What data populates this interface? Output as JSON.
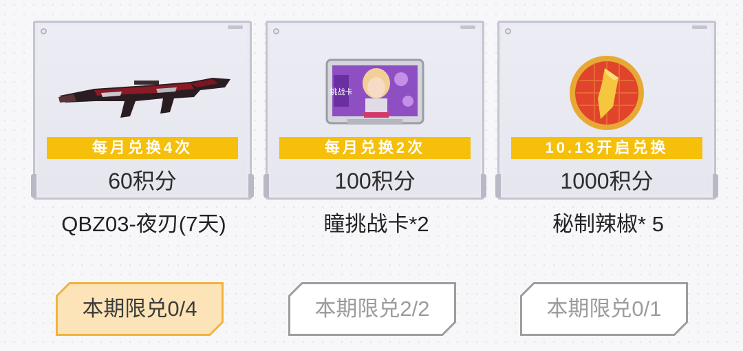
{
  "items": [
    {
      "image_icon": "rifle-icon",
      "limit_banner": "每月兑换4次",
      "price": "60积分",
      "name": "QBZ03-夜刃(7天)",
      "button_label": "本期限兑0/4",
      "button_state": "active"
    },
    {
      "image_icon": "challenge-card-icon",
      "limit_banner": "每月兑换2次",
      "price": "100积分",
      "name": "瞳挑战卡*2",
      "button_label": "本期限兑2/2",
      "button_state": "disabled",
      "image_text": "挑战卡"
    },
    {
      "image_icon": "chili-coin-icon",
      "limit_banner": "10.13开启兑换",
      "price": "1000积分",
      "name": "秘制辣椒* 5",
      "button_label": "本期限兑0/1",
      "button_state": "disabled"
    }
  ],
  "colors": {
    "banner": "#f5bf0a",
    "active_button_fill": "#fde4b8",
    "active_button_border": "#f2b23b",
    "disabled_button_border": "#9d9d9d"
  }
}
